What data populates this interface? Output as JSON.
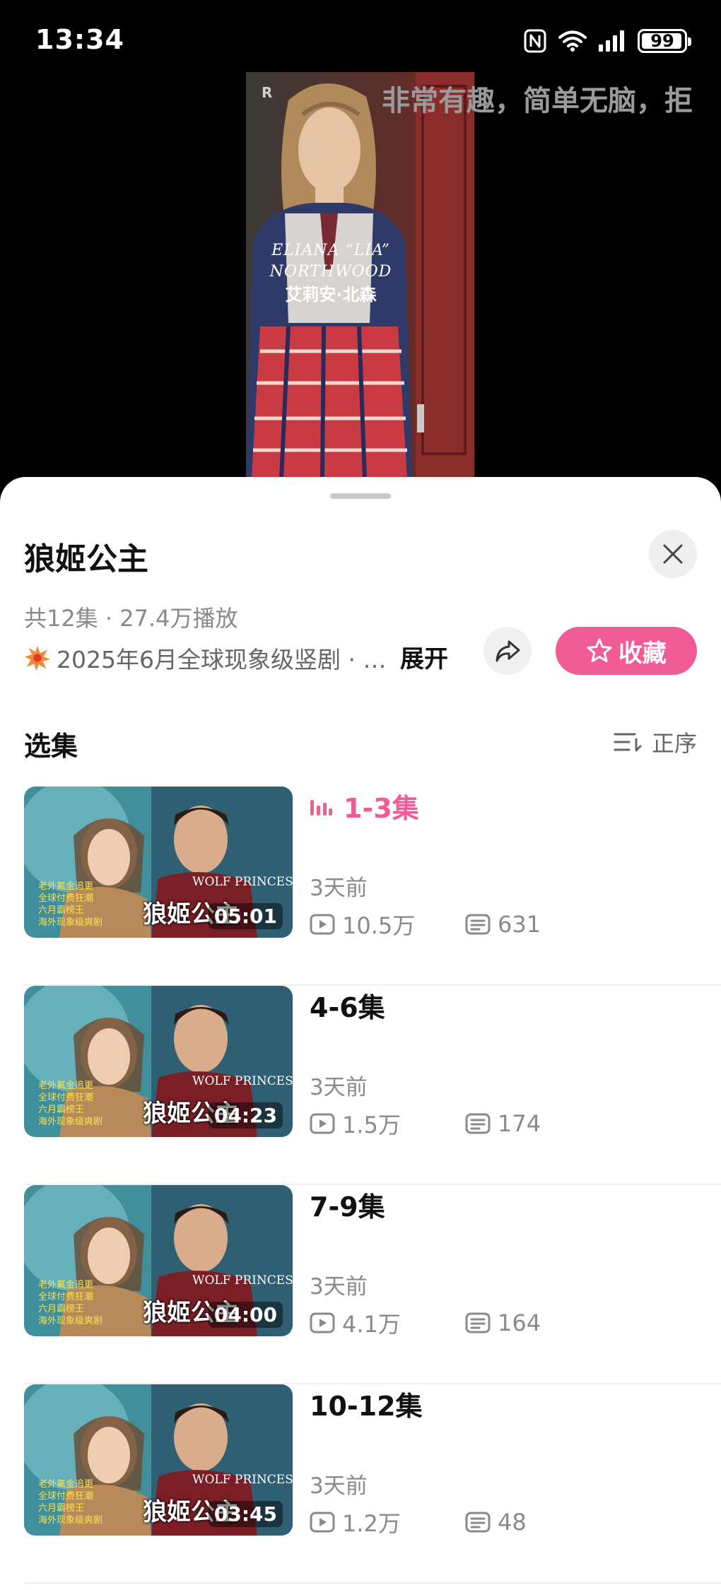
{
  "status": {
    "time": "13:34",
    "battery": "99"
  },
  "video": {
    "overlay_text": "非常有趣，简单无脑，拒",
    "caption_en_line1": "ELIANA “LIA”",
    "caption_en_line2": "NORTHWOOD",
    "caption_cn": "艾莉安·北森"
  },
  "sheet": {
    "title": "狼姬公主",
    "meta": "共12集 · 27.4万播放",
    "description": "2025年6月全球现象级竖剧 · …",
    "expand_label": "展开",
    "favorite_label": "收藏",
    "section_title": "选集",
    "sort_label": "正序"
  },
  "episodes": [
    {
      "title": "1-3集",
      "date": "3天前",
      "views": "10.5万",
      "comments": "631",
      "duration": "05:01",
      "thumb_title": "狼姬公主",
      "active": true
    },
    {
      "title": "4-6集",
      "date": "3天前",
      "views": "1.5万",
      "comments": "174",
      "duration": "04:23",
      "thumb_title": "狼姬公主",
      "active": false
    },
    {
      "title": "7-9集",
      "date": "3天前",
      "views": "4.1万",
      "comments": "164",
      "duration": "04:00",
      "thumb_title": "狼姬公主",
      "active": false
    },
    {
      "title": "10-12集",
      "date": "3天前",
      "views": "1.2万",
      "comments": "48",
      "duration": "03:45",
      "thumb_title": "狼姬公主",
      "active": false
    }
  ],
  "icons": {
    "close": "close-icon",
    "share": "share-icon",
    "favorite": "star-icon",
    "sort": "sort-icon",
    "playing": "equalizer-icon",
    "views": "play-count-icon",
    "comments": "comment-icon",
    "description": "burst-icon"
  },
  "colors": {
    "accent": "#f25c95",
    "sheet_bg": "#ffffff",
    "muted_text": "#8a8a8a"
  }
}
